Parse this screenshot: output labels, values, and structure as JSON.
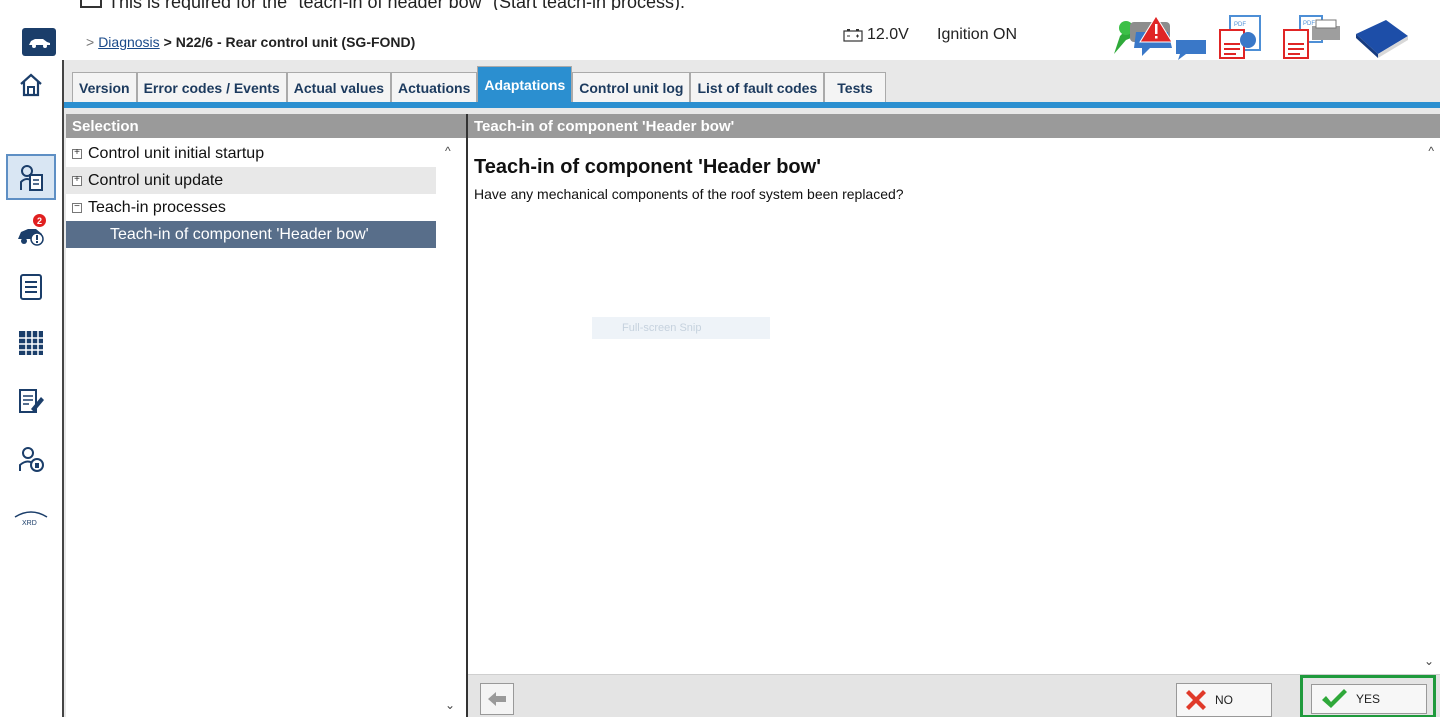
{
  "caption": {
    "text": "This is required for the \"teach-in of header bow\" (Start teach-in process)."
  },
  "header": {
    "breadcrumb_sep": ">",
    "breadcrumb_link": "Diagnosis",
    "breadcrumb_current": "> N22/6 - Rear control unit (SG-FOND)",
    "voltage": "12.0V",
    "ignition": "Ignition ON"
  },
  "sidebar": {
    "badge": "2",
    "xrd_label": "XRD"
  },
  "tabs": [
    {
      "label": "Version"
    },
    {
      "label": "Error codes / Events"
    },
    {
      "label": "Actual values"
    },
    {
      "label": "Actuations"
    },
    {
      "label": "Adaptations"
    },
    {
      "label": "Control unit log"
    },
    {
      "label": "List of fault codes"
    },
    {
      "label": "Tests"
    }
  ],
  "left_pane": {
    "title": "Selection",
    "tree": [
      {
        "label": "Control unit initial startup",
        "expander": "+"
      },
      {
        "label": "Control unit update",
        "expander": "+"
      },
      {
        "label": "Teach-in processes",
        "expander": "−"
      },
      {
        "label": "Teach-in of component 'Header bow'"
      }
    ]
  },
  "right_pane": {
    "title": "Teach-in of component 'Header bow'",
    "heading": "Teach-in of component 'Header bow'",
    "question": "Have any mechanical components of the roof system been replaced?",
    "snip_label": "Full-screen Snip"
  },
  "footer": {
    "no_label": "NO",
    "yes_label": "YES"
  },
  "colors": {
    "accent": "#2b8fd0",
    "header_gray": "#9a9a9a",
    "selected_row": "#586e8a",
    "yes_highlight": "#1f9a3c",
    "no_red": "#e03a2a"
  }
}
